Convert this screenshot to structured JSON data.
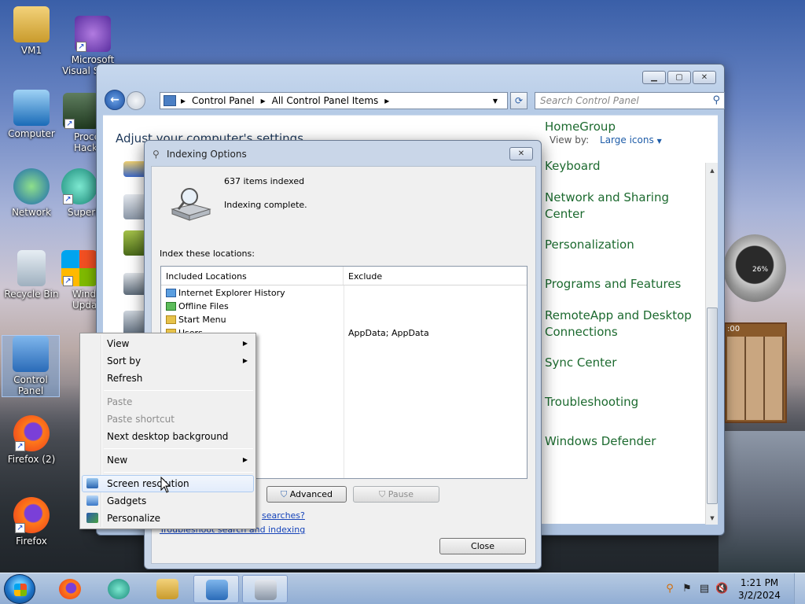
{
  "desktop": {
    "icons": [
      {
        "label": "VM1"
      },
      {
        "label": "Microsoft Visual Studio"
      },
      {
        "label": "Computer"
      },
      {
        "label": "Process Hacker"
      },
      {
        "label": "Network"
      },
      {
        "label": "SuperM..."
      },
      {
        "label": "Recycle Bin"
      },
      {
        "label": "Windows Update"
      },
      {
        "label": "Control Panel"
      },
      {
        "label": "Firefox (2)"
      },
      {
        "label": "Firefox"
      }
    ]
  },
  "control_panel": {
    "address": [
      "Control Panel",
      "All Control Panel Items"
    ],
    "search_placeholder": "Search Control Panel",
    "heading": "Adjust your computer's settings",
    "view_by_label": "View by:",
    "view_by_value": "Large icons",
    "items": [
      "HomeGroup",
      "Keyboard",
      "Network and Sharing Center",
      "Personalization",
      "Programs and Features",
      "RemoteApp and Desktop Connections",
      "Sync Center",
      "Troubleshooting",
      "Windows Defender"
    ]
  },
  "indexing": {
    "title": "Indexing Options",
    "items_indexed": "637 items indexed",
    "status": "Indexing complete.",
    "index_label": "Index these locations:",
    "col_included": "Included Locations",
    "col_exclude": "Exclude",
    "locations": [
      {
        "name": "Internet Explorer History",
        "exclude": ""
      },
      {
        "name": "Offline Files",
        "exclude": ""
      },
      {
        "name": "Start Menu",
        "exclude": ""
      },
      {
        "name": "Users",
        "exclude": "AppData; AppData"
      }
    ],
    "advanced_label": "Advanced",
    "pause_label": "Pause",
    "link_searches": "searches?",
    "link_troubleshoot": "Troubleshoot search and indexing",
    "close_label": "Close"
  },
  "context_menu": {
    "view": "View",
    "sort_by": "Sort by",
    "refresh": "Refresh",
    "paste": "Paste",
    "paste_shortcut": "Paste shortcut",
    "next_bg": "Next desktop background",
    "new": "New",
    "screen_resolution": "Screen resolution",
    "gadgets": "Gadgets",
    "personalize": "Personalize"
  },
  "gadgets": {
    "cpu_percent": "26%",
    "puzzle_time": ":00"
  },
  "taskbar": {
    "time": "1:21 PM",
    "date": "3/2/2024"
  },
  "colors": {
    "link_green": "#1c6a2f",
    "link_blue": "#1543b9"
  }
}
